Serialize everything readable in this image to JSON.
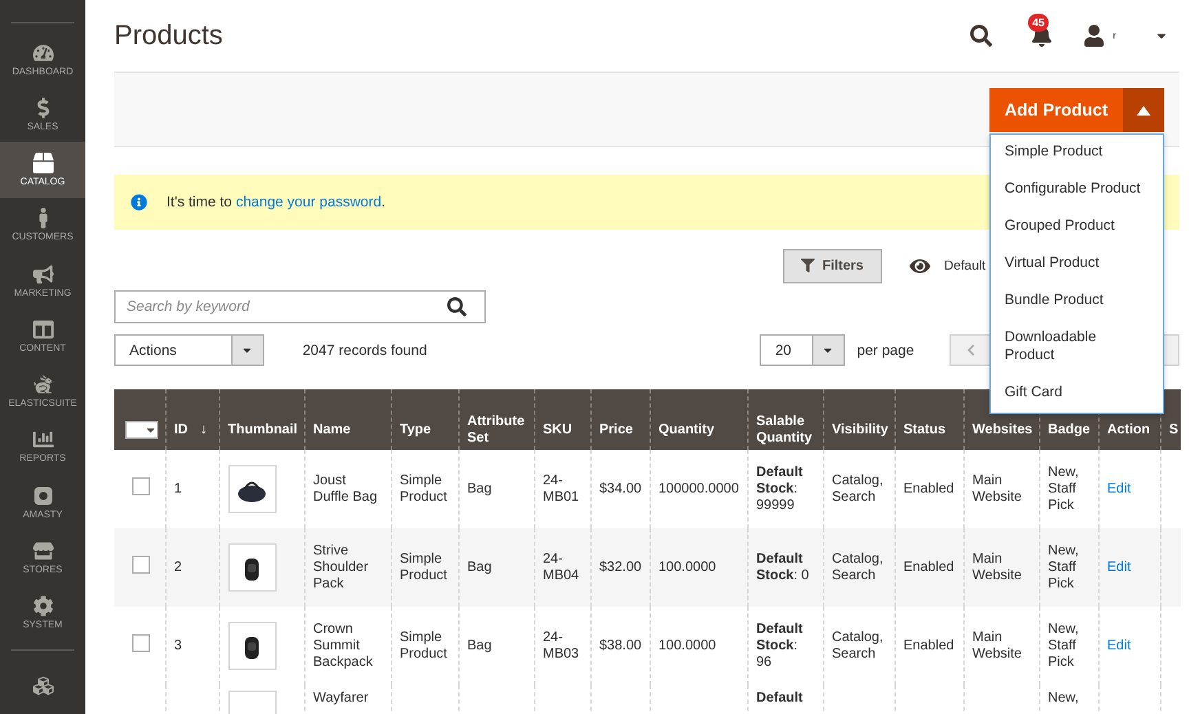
{
  "sidebar": {
    "items": [
      {
        "label": "DASHBOARD",
        "selected": false
      },
      {
        "label": "SALES",
        "selected": false
      },
      {
        "label": "CATALOG",
        "selected": true
      },
      {
        "label": "CUSTOMERS",
        "selected": false
      },
      {
        "label": "MARKETING",
        "selected": false
      },
      {
        "label": "CONTENT",
        "selected": false
      },
      {
        "label": "ELASTICSUITE",
        "selected": false
      },
      {
        "label": "REPORTS",
        "selected": false
      },
      {
        "label": "AMASTY",
        "selected": false
      },
      {
        "label": "STORES",
        "selected": false
      },
      {
        "label": "SYSTEM",
        "selected": false
      }
    ]
  },
  "header": {
    "title": "Products",
    "notification_count": "45",
    "user_name": "r"
  },
  "add_product": {
    "label": "Add Product",
    "expanded": true,
    "menu": [
      "Simple Product",
      "Configurable Product",
      "Grouped Product",
      "Virtual Product",
      "Bundle Product",
      "Downloadable Product",
      "Gift Card"
    ]
  },
  "notice": {
    "text": "It's time to ",
    "link": "change your password",
    "end": "."
  },
  "toolbar": {
    "filters": "Filters",
    "view": "Default",
    "search": {
      "placeholder": "Search by keyword"
    },
    "actions": "Actions",
    "records": "2047 records found",
    "per_page_value": "20",
    "per_page_label": "per page"
  },
  "table": {
    "columns": [
      {
        "label": "ID",
        "sort_mark": "↓"
      },
      {
        "label": "Thumbnail"
      },
      {
        "label": "Name"
      },
      {
        "label": "Type"
      },
      {
        "label": "Attribute Set"
      },
      {
        "label": "SKU"
      },
      {
        "label": "Price"
      },
      {
        "label": "Quantity"
      },
      {
        "label": "Salable Quantity"
      },
      {
        "label": "Visibility"
      },
      {
        "label": "Status"
      },
      {
        "label": "Websites"
      },
      {
        "label": "Badge"
      },
      {
        "label": "Action"
      },
      {
        "label": "S"
      }
    ],
    "all_checked": false,
    "rows": [
      {
        "checked": false,
        "id": "1",
        "name": "Joust Duffle Bag",
        "type": "Simple Product",
        "attribute_set": "Bag",
        "sku": "24-MB01",
        "price": "$34.00",
        "quantity": "100000.0000",
        "salable": "**Default Stock**: 99999",
        "visibility": "Catalog, Search",
        "status": "Enabled",
        "websites": "Main Website",
        "badge": "New, Staff Pick",
        "action": "Edit"
      },
      {
        "checked": false,
        "id": "2",
        "name": "Strive Shoulder Pack",
        "type": "Simple Product",
        "attribute_set": "Bag",
        "sku": "24-MB04",
        "price": "$32.00",
        "quantity": "100.0000",
        "salable": "**Default Stock**: 0",
        "visibility": "Catalog, Search",
        "status": "Enabled",
        "websites": "Main Website",
        "badge": "New, Staff Pick",
        "action": "Edit"
      },
      {
        "checked": false,
        "id": "3",
        "name": "Crown Summit Backpack",
        "type": "Simple Product",
        "attribute_set": "Bag",
        "sku": "24-MB03",
        "price": "$38.00",
        "quantity": "100.0000",
        "salable": "**Default Stock**: 96",
        "visibility": "Catalog, Search",
        "status": "Enabled",
        "websites": "Main Website",
        "badge": "New, Staff Pick",
        "action": "Edit"
      }
    ],
    "partial_row": {
      "name": "Wayfarer",
      "salable": "Default",
      "badge": "New,"
    }
  }
}
